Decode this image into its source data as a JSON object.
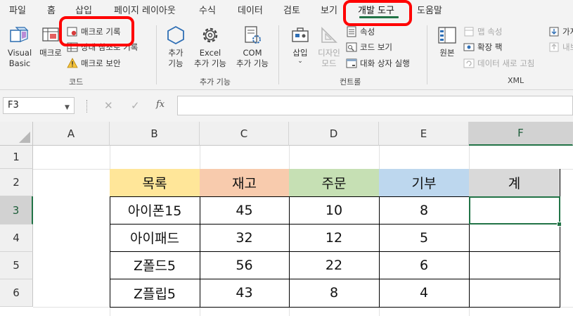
{
  "menu": {
    "tabs": [
      "파일",
      "홈",
      "삽입",
      "페이지 레이아웃",
      "수식",
      "데이터",
      "검토",
      "보기",
      "개발 도구",
      "도움말"
    ],
    "active": "개발 도구"
  },
  "ribbon": {
    "code_group": {
      "label": "코드",
      "visual_basic": "Visual\nBasic",
      "macro": "매크로",
      "record_macro": "매크로 기록",
      "relative_refs": "상대 참조로 기록",
      "macro_security": "매크로 보안"
    },
    "addins_group": {
      "label": "추가 기능",
      "addins": "추가\n기능",
      "excel_addins": "Excel\n추가 기능",
      "com_addins": "COM\n추가 기능"
    },
    "controls_group": {
      "label": "컨트롤",
      "insert": "삽입",
      "design_mode": "디자인\n모드",
      "properties": "속성",
      "view_code": "코드 보기",
      "run_dialog": "대화 상자 실행"
    },
    "xml_group": {
      "label": "XML",
      "source": "원본",
      "map_properties": "맵 속성",
      "expansion_packs": "확장 팩",
      "refresh_data": "데이터 새로 고침",
      "import_partial": "가져",
      "export_partial": "내보"
    }
  },
  "formula_bar": {
    "name_box": "F3",
    "formula": "",
    "cancel_glyph": "✕",
    "enter_glyph": "✓",
    "fx_glyph": "fx"
  },
  "sheet": {
    "columns": [
      "A",
      "B",
      "C",
      "D",
      "E",
      "F"
    ],
    "rows": [
      "1",
      "2",
      "3",
      "4",
      "5",
      "6"
    ],
    "selected_cell": "F3",
    "headers": [
      "목록",
      "재고",
      "주문",
      "기부",
      "계"
    ],
    "header_colors": [
      "#ffe699",
      "#f8cbad",
      "#c6e0b4",
      "#bdd7ee",
      "#d9d9d9"
    ],
    "data": [
      [
        "아이폰15",
        "45",
        "10",
        "8",
        ""
      ],
      [
        "아이패드",
        "32",
        "12",
        "5",
        ""
      ],
      [
        "Z폴드5",
        "56",
        "22",
        "6",
        ""
      ],
      [
        "Z플립5",
        "43",
        "8",
        "4",
        ""
      ]
    ]
  },
  "colors": {
    "accent": "#217346",
    "callout": "#ff0000"
  }
}
